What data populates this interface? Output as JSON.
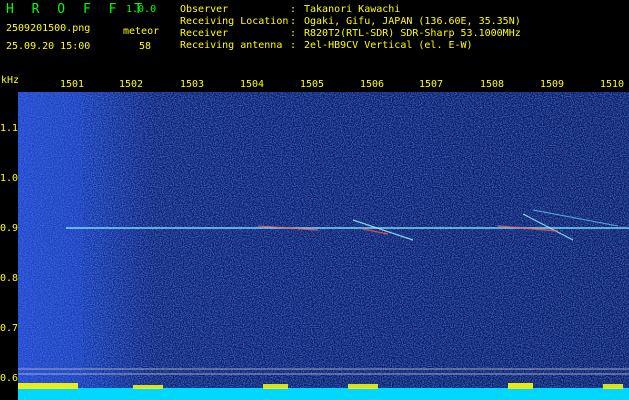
{
  "header": {
    "app_name": "H R O F F T",
    "version": "1.0.0",
    "file_name": "2509201500.png",
    "datetime": "25.09.20 15:00",
    "meteor_label": "meteor",
    "meteor_count": "58"
  },
  "station": {
    "rows": [
      {
        "label": "Observer",
        "value": "Takanori Kawachi"
      },
      {
        "label": "Receiving Location",
        "value": "Ogaki, Gifu, JAPAN (136.60E, 35.35N)"
      },
      {
        "label": "Receiver",
        "value": "R820T2(RTL-SDR) SDR-Sharp 53.1000MHz"
      },
      {
        "label": "Receiving antenna",
        "value": "2el-HB9CV Vertical (el. E-W)"
      }
    ],
    "separator": ":"
  },
  "axes": {
    "freq_unit": "kHz",
    "y_ticks": [
      "1.1",
      "1.0",
      "0.9",
      "0.8",
      "0.7",
      "0.6"
    ],
    "x_ticks": [
      "1501",
      "1502",
      "1503",
      "1504",
      "1505",
      "1506",
      "1507",
      "1508",
      "1509",
      "1510"
    ]
  },
  "colors": {
    "background": "#000000",
    "header_text": "#ffff00",
    "app_name": "#00ff00",
    "carrier_line": "#7fe8ff",
    "baseline_band": "#00d8ff"
  }
}
